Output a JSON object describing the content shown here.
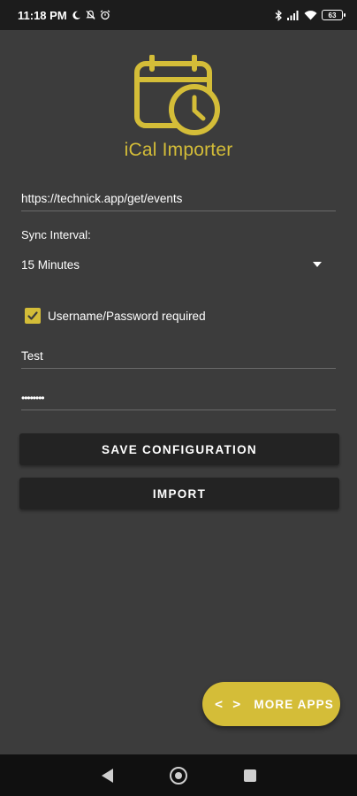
{
  "status_bar": {
    "time": "11:18 PM",
    "battery": "63"
  },
  "app": {
    "title": "iCal Importer"
  },
  "form": {
    "url_value": "https://technick.app/get/events",
    "sync_label": "Sync Interval:",
    "sync_value": "15 Minutes",
    "auth_checkbox_label": "Username/Password required",
    "auth_checked": true,
    "username_value": "Test",
    "password_value": "••••••••"
  },
  "buttons": {
    "save_label": "SAVE CONFIGURATION",
    "import_label": "IMPORT"
  },
  "fab": {
    "icon": "< >",
    "label": "MORE APPS"
  },
  "colors": {
    "accent": "#d4bd38",
    "background": "#3c3c3c",
    "button": "#232323",
    "status_bar": "#1c1c1c",
    "nav_bar": "#101010"
  }
}
